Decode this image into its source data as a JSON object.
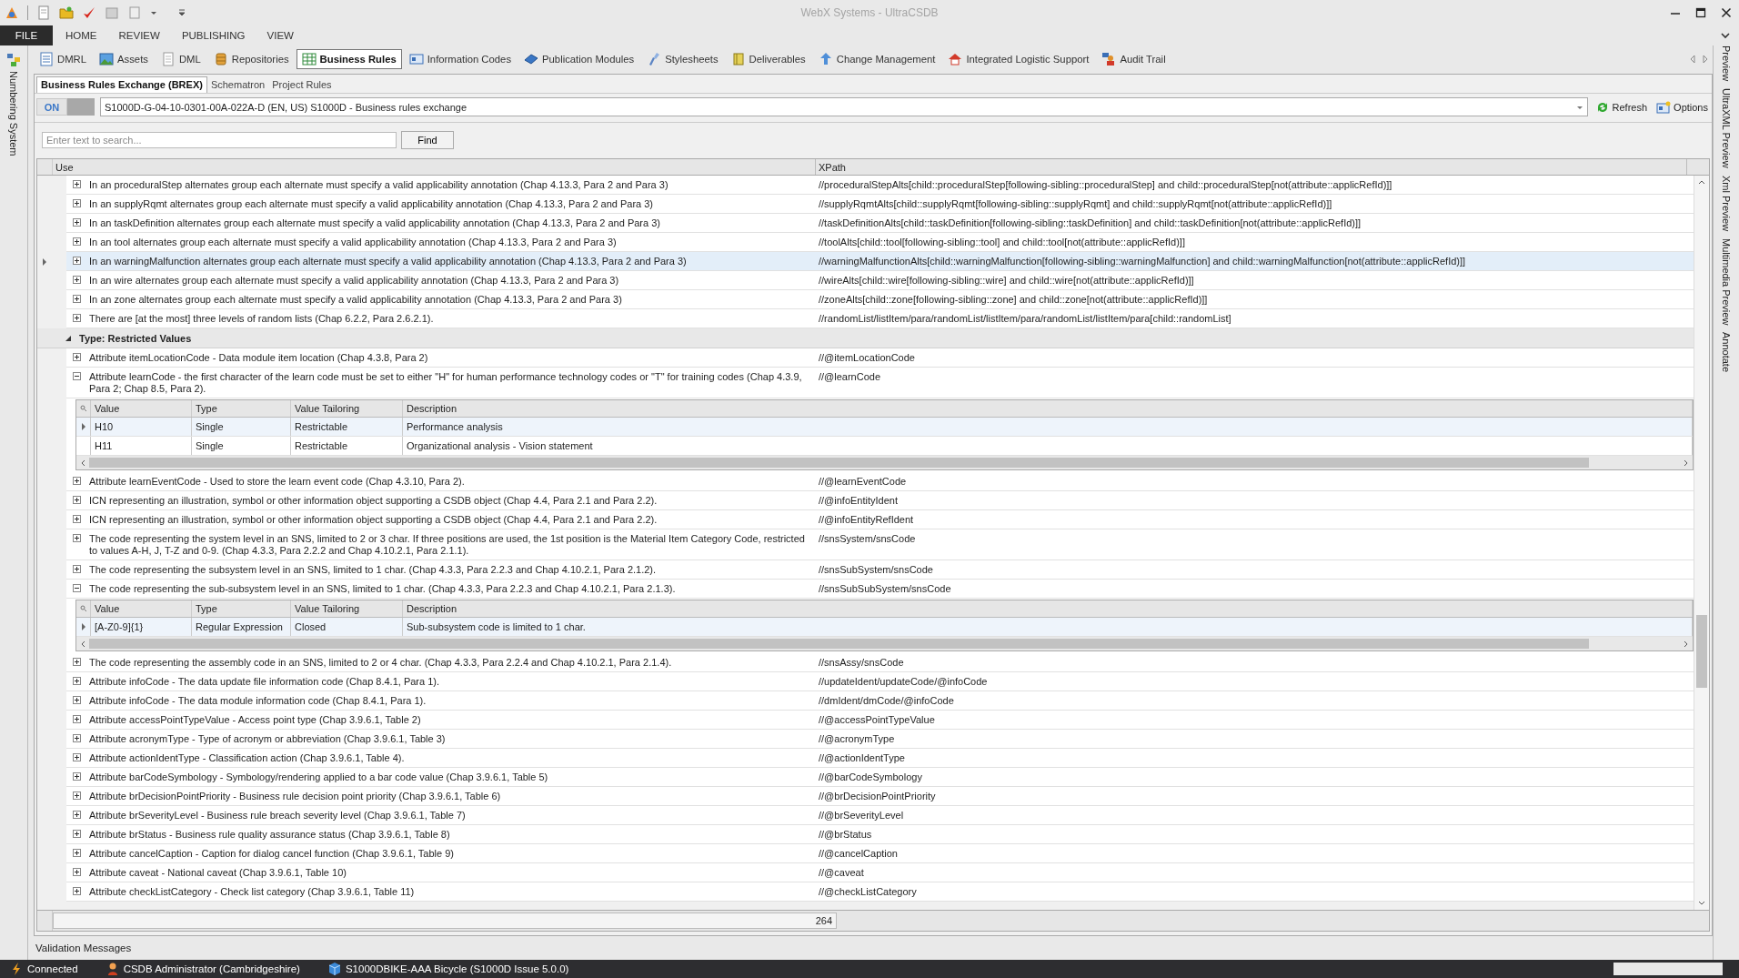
{
  "window": {
    "title": "WebX Systems - UltraCSDB"
  },
  "ribbon_tabs": [
    {
      "label": "FILE",
      "kind": "file"
    },
    {
      "label": "HOME",
      "kind": "tab"
    },
    {
      "label": "REVIEW",
      "kind": "tab"
    },
    {
      "label": "PUBLISHING",
      "kind": "tab"
    },
    {
      "label": "VIEW",
      "kind": "tab"
    }
  ],
  "modules": [
    {
      "label": "DMRL",
      "selected": false
    },
    {
      "label": "Assets",
      "selected": false
    },
    {
      "label": "DML",
      "selected": false
    },
    {
      "label": "Repositories",
      "selected": false
    },
    {
      "label": "Business Rules",
      "selected": true
    },
    {
      "label": "Information Codes",
      "selected": false
    },
    {
      "label": "Publication Modules",
      "selected": false
    },
    {
      "label": "Stylesheets",
      "selected": false
    },
    {
      "label": "Deliverables",
      "selected": false
    },
    {
      "label": "Change Management",
      "selected": false
    },
    {
      "label": "Integrated Logistic Support",
      "selected": false
    },
    {
      "label": "Audit Trail",
      "selected": false
    }
  ],
  "left_panel": {
    "label": "Numbering System"
  },
  "right_panels": [
    "Preview",
    "UltraXML Preview",
    "Xml Preview",
    "Multimedia Preview",
    "Annotate"
  ],
  "sub_tabs": [
    {
      "label": "Business Rules Exchange (BREX)",
      "selected": true
    },
    {
      "label": "Schematron",
      "selected": false
    },
    {
      "label": "Project Rules",
      "selected": false
    }
  ],
  "brex": {
    "toggle": {
      "label": "ON",
      "on": true
    },
    "document": "S1000D-G-04-10-0301-00A-022A-D (EN, US) S1000D - Business rules exchange",
    "actions": [
      "Refresh",
      "Options"
    ]
  },
  "search": {
    "placeholder": "Enter text to search...",
    "button": "Find"
  },
  "grid": {
    "columns": [
      "Use",
      "XPath"
    ],
    "count": "264",
    "rows": [
      {
        "kind": "rule",
        "use": "In an proceduralStep alternates group each alternate must specify a valid applicability annotation  (Chap 4.13.3, Para 2 and Para 3)",
        "xpath": "//proceduralStepAlts[child::proceduralStep[following-sibling::proceduralStep] and child::proceduralStep[not(attribute::applicRefId)]]",
        "expanded": false,
        "selected": false
      },
      {
        "kind": "rule",
        "use": "In an supplyRqmt alternates group each alternate must specify a valid applicability annotation  (Chap 4.13.3, Para 2 and Para 3)",
        "xpath": "//supplyRqmtAlts[child::supplyRqmt[following-sibling::supplyRqmt] and child::supplyRqmt[not(attribute::applicRefId)]]",
        "expanded": false,
        "selected": false
      },
      {
        "kind": "rule",
        "use": "In an taskDefinition alternates group each alternate must specify a valid applicability annotation  (Chap 4.13.3, Para 2 and Para 3)",
        "xpath": "//taskDefinitionAlts[child::taskDefinition[following-sibling::taskDefinition] and child::taskDefinition[not(attribute::applicRefId)]]",
        "expanded": false,
        "selected": false
      },
      {
        "kind": "rule",
        "use": "In an tool alternates group each alternate must specify a valid applicability annotation  (Chap 4.13.3, Para 2 and Para 3)",
        "xpath": "//toolAlts[child::tool[following-sibling::tool] and child::tool[not(attribute::applicRefId)]]",
        "expanded": false,
        "selected": false
      },
      {
        "kind": "rule",
        "use": "In an warningMalfunction alternates group each alternate must specify a valid applicability annotation  (Chap 4.13.3, Para 2 and Para 3)",
        "xpath": "//warningMalfunctionAlts[child::warningMalfunction[following-sibling::warningMalfunction] and child::warningMalfunction[not(attribute::applicRefId)]]",
        "expanded": false,
        "selected": true
      },
      {
        "kind": "rule",
        "use": "In an wire alternates group each alternate must specify a valid applicability annotation  (Chap 4.13.3, Para 2 and Para 3)",
        "xpath": "//wireAlts[child::wire[following-sibling::wire] and child::wire[not(attribute::applicRefId)]]",
        "expanded": false,
        "selected": false
      },
      {
        "kind": "rule",
        "use": "In an zone alternates group each alternate must specify a valid applicability annotation  (Chap 4.13.3, Para 2 and Para 3)",
        "xpath": "//zoneAlts[child::zone[following-sibling::zone] and child::zone[not(attribute::applicRefId)]]",
        "expanded": false,
        "selected": false
      },
      {
        "kind": "rule",
        "use": "There are [at the most] three levels of random lists (Chap 6.2.2, Para 2.6.2.1).",
        "xpath": "//randomList/listItem/para/randomList/listItem/para/randomList/listItem/para[child::randomList]",
        "expanded": false,
        "selected": false
      },
      {
        "kind": "group",
        "label": "Type: Restricted Values",
        "expanded": true
      },
      {
        "kind": "rule",
        "use": "Attribute itemLocationCode - Data module item location (Chap 4.3.8, Para 2)",
        "xpath": "//@itemLocationCode",
        "expanded": false,
        "selected": false
      },
      {
        "kind": "rule",
        "use": "Attribute learnCode - the first character of the learn code must be set to either \"H\" for human performance technology codes or \"T\" for training codes (Chap 4.3.9, Para 2; Chap 8.5, Para 2).",
        "xpath": "//@learnCode",
        "expanded": true,
        "selected": false,
        "detail": {
          "columns": [
            "Value",
            "Type",
            "Value Tailoring",
            "Description"
          ],
          "rows": [
            {
              "cells": [
                "H10",
                "Single",
                "Restrictable",
                "Performance analysis"
              ],
              "selected": true
            },
            {
              "cells": [
                "H11",
                "Single",
                "Restrictable",
                "Organizational analysis - Vision statement"
              ],
              "selected": false
            }
          ]
        }
      },
      {
        "kind": "rule",
        "use": "Attribute learnEventCode - Used to store the learn event code (Chap 4.3.10, Para 2).",
        "xpath": "//@learnEventCode",
        "expanded": false,
        "selected": false
      },
      {
        "kind": "rule",
        "use": "ICN representing an illustration, symbol or other information object supporting a CSDB object (Chap 4.4, Para 2.1 and Para 2.2).",
        "xpath": "//@infoEntityIdent",
        "expanded": false,
        "selected": false
      },
      {
        "kind": "rule",
        "use": "ICN representing an illustration, symbol or other information object supporting a CSDB object (Chap 4.4, Para 2.1 and Para 2.2).",
        "xpath": "//@infoEntityRefIdent",
        "expanded": false,
        "selected": false
      },
      {
        "kind": "rule",
        "use": "The code representing the system level in an SNS, limited to 2 or 3 char. If three positions are used, the 1st position is the Material Item Category Code, restricted to values A-H, J, T-Z and 0-9. (Chap 4.3.3, Para 2.2.2 and Chap 4.10.2.1, Para 2.1.1).",
        "xpath": "//snsSystem/snsCode",
        "expanded": false,
        "selected": false
      },
      {
        "kind": "rule",
        "use": "The code representing the subsystem level in an SNS, limited to 1 char. (Chap 4.3.3, Para 2.2.3 and Chap 4.10.2.1, Para 2.1.2).",
        "xpath": "//snsSubSystem/snsCode",
        "expanded": false,
        "selected": false
      },
      {
        "kind": "rule",
        "use": "The code representing the sub-subsystem level in an SNS, limited to 1 char. (Chap 4.3.3, Para 2.2.3 and Chap 4.10.2.1, Para 2.1.3).",
        "xpath": "//snsSubSubSystem/snsCode",
        "expanded": true,
        "selected": false,
        "detail": {
          "columns": [
            "Value",
            "Type",
            "Value Tailoring",
            "Description"
          ],
          "rows": [
            {
              "cells": [
                "[A-Z0-9]{1}",
                "Regular Expression",
                "Closed",
                "Sub-subsystem code is limited to 1 char."
              ],
              "selected": true
            }
          ]
        }
      },
      {
        "kind": "rule",
        "use": "The code representing the assembly code in an SNS, limited to 2 or 4 char. (Chap 4.3.3, Para 2.2.4 and Chap 4.10.2.1, Para 2.1.4).",
        "xpath": "//snsAssy/snsCode",
        "expanded": false,
        "selected": false
      },
      {
        "kind": "rule",
        "use": "Attribute infoCode - The data update file information code (Chap 8.4.1, Para 1).",
        "xpath": "//updateIdent/updateCode/@infoCode",
        "expanded": false,
        "selected": false
      },
      {
        "kind": "rule",
        "use": "Attribute infoCode - The data module information code (Chap 8.4.1, Para 1).",
        "xpath": "//dmIdent/dmCode/@infoCode",
        "expanded": false,
        "selected": false
      },
      {
        "kind": "rule",
        "use": "Attribute accessPointTypeValue - Access point type (Chap 3.9.6.1, Table 2)",
        "xpath": "//@accessPointTypeValue",
        "expanded": false,
        "selected": false
      },
      {
        "kind": "rule",
        "use": "Attribute acronymType - Type of acronym or abbreviation (Chap 3.9.6.1, Table 3)",
        "xpath": "//@acronymType",
        "expanded": false,
        "selected": false
      },
      {
        "kind": "rule",
        "use": "Attribute actionIdentType - Classification action (Chap 3.9.6.1, Table 4).",
        "xpath": "//@actionIdentType",
        "expanded": false,
        "selected": false
      },
      {
        "kind": "rule",
        "use": "Attribute barCodeSymbology - Symbology/rendering applied to a bar code value (Chap 3.9.6.1, Table 5)",
        "xpath": "//@barCodeSymbology",
        "expanded": false,
        "selected": false
      },
      {
        "kind": "rule",
        "use": "Attribute brDecisionPointPriority - Business rule decision point priority (Chap 3.9.6.1, Table 6)",
        "xpath": "//@brDecisionPointPriority",
        "expanded": false,
        "selected": false
      },
      {
        "kind": "rule",
        "use": "Attribute brSeverityLevel - Business rule breach severity level (Chap 3.9.6.1, Table 7)",
        "xpath": "//@brSeverityLevel",
        "expanded": false,
        "selected": false
      },
      {
        "kind": "rule",
        "use": "Attribute brStatus - Business rule quality assurance status (Chap 3.9.6.1, Table 8)",
        "xpath": "//@brStatus",
        "expanded": false,
        "selected": false
      },
      {
        "kind": "rule",
        "use": "Attribute cancelCaption - Caption for dialog cancel function (Chap 3.9.6.1, Table 9)",
        "xpath": "//@cancelCaption",
        "expanded": false,
        "selected": false
      },
      {
        "kind": "rule",
        "use": "Attribute caveat - National caveat (Chap 3.9.6.1, Table 10)",
        "xpath": "//@caveat",
        "expanded": false,
        "selected": false
      },
      {
        "kind": "rule",
        "use": "Attribute checkListCategory - Check list category (Chap 3.9.6.1, Table 11)",
        "xpath": "//@checkListCategory",
        "expanded": false,
        "selected": false
      }
    ]
  },
  "validation": {
    "label": "Validation Messages"
  },
  "status_bar": {
    "items": [
      {
        "kind": "connection",
        "label": "Connected"
      },
      {
        "kind": "user",
        "label": "CSDB Administrator (Cambridgeshire)"
      },
      {
        "kind": "project",
        "label": "S1000DBIKE-AAA Bicycle (S1000D Issue 5.0.0)"
      }
    ]
  }
}
